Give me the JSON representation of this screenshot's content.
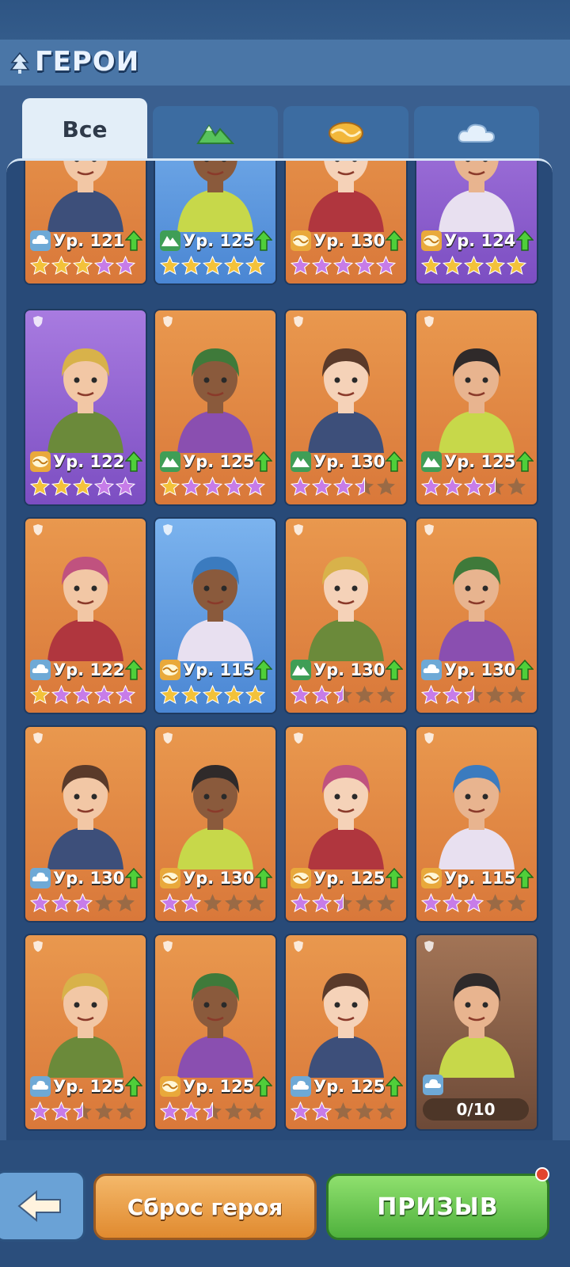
{
  "header": {
    "title": "ГЕРОИ",
    "title_icon": "tree-icon"
  },
  "tabs": [
    {
      "label": "Все",
      "active": true
    },
    {
      "icon": "mountain-icon"
    },
    {
      "icon": "desert-icon"
    },
    {
      "icon": "cloud-icon"
    }
  ],
  "colors": {
    "cloud": "#6ea9d6",
    "mountain": "#3f9e56",
    "desert": "#e9a93b",
    "star_gold": "#f3c23a",
    "star_purple": "#c77ce8",
    "star_empty": "#9a6a45"
  },
  "heroes": [
    {
      "bg": "orange",
      "element": "cloud",
      "level": "Ур. 121",
      "gold": 3,
      "purple": 2,
      "half": 0,
      "empty": 0
    },
    {
      "bg": "blue",
      "element": "mount",
      "level": "Ур. 125",
      "gold": 5,
      "purple": 0,
      "half": 0,
      "empty": 0
    },
    {
      "bg": "orange",
      "element": "desert",
      "level": "Ур. 130",
      "gold": 0,
      "purple": 5,
      "half": 0,
      "empty": 0
    },
    {
      "bg": "purple",
      "element": "desert",
      "level": "Ур. 124",
      "gold": 5,
      "purple": 0,
      "half": 0,
      "empty": 0
    },
    {
      "bg": "purple",
      "element": "desert",
      "level": "Ур. 122",
      "gold": 3,
      "purple": 2,
      "half": 0,
      "empty": 0
    },
    {
      "bg": "orange",
      "element": "mount",
      "level": "Ур. 125",
      "gold": 1,
      "purple": 4,
      "half": 0,
      "empty": 0
    },
    {
      "bg": "orange",
      "element": "mount",
      "level": "Ур. 130",
      "gold": 0,
      "purple": 3,
      "half": 1,
      "empty": 1
    },
    {
      "bg": "orange",
      "element": "mount",
      "level": "Ур. 125",
      "gold": 0,
      "purple": 3,
      "half": 1,
      "empty": 1
    },
    {
      "bg": "orange",
      "element": "cloud",
      "level": "Ур. 122",
      "gold": 1,
      "purple": 4,
      "half": 0,
      "empty": 0
    },
    {
      "bg": "blue",
      "element": "desert",
      "level": "Ур. 115",
      "gold": 5,
      "purple": 0,
      "half": 0,
      "empty": 0
    },
    {
      "bg": "orange",
      "element": "mount",
      "level": "Ур. 130",
      "gold": 0,
      "purple": 2,
      "half": 1,
      "empty": 2
    },
    {
      "bg": "orange",
      "element": "cloud",
      "level": "Ур. 130",
      "gold": 0,
      "purple": 2,
      "half": 1,
      "empty": 2
    },
    {
      "bg": "orange",
      "element": "cloud",
      "level": "Ур. 130",
      "gold": 0,
      "purple": 3,
      "half": 0,
      "empty": 2
    },
    {
      "bg": "orange",
      "element": "desert",
      "level": "Ур. 130",
      "gold": 0,
      "purple": 2,
      "half": 0,
      "empty": 3
    },
    {
      "bg": "orange",
      "element": "desert",
      "level": "Ур. 125",
      "gold": 0,
      "purple": 2,
      "half": 1,
      "empty": 2
    },
    {
      "bg": "orange",
      "element": "desert",
      "level": "Ур. 115",
      "gold": 0,
      "purple": 3,
      "half": 0,
      "empty": 2
    },
    {
      "bg": "orange",
      "element": "cloud",
      "level": "Ур. 125",
      "gold": 0,
      "purple": 2,
      "half": 1,
      "empty": 2
    },
    {
      "bg": "orange",
      "element": "desert",
      "level": "Ур. 125",
      "gold": 0,
      "purple": 2,
      "half": 1,
      "empty": 2
    },
    {
      "bg": "orange",
      "element": "cloud",
      "level": "Ур. 125",
      "gold": 0,
      "purple": 2,
      "half": 0,
      "empty": 3
    }
  ],
  "locked_hero": {
    "element": "cloud",
    "progress": "0/10"
  },
  "footer": {
    "reset_label": "Сброс героя",
    "summon_label": "ПРИЗЫВ",
    "back_icon": "back-arrow-icon"
  }
}
